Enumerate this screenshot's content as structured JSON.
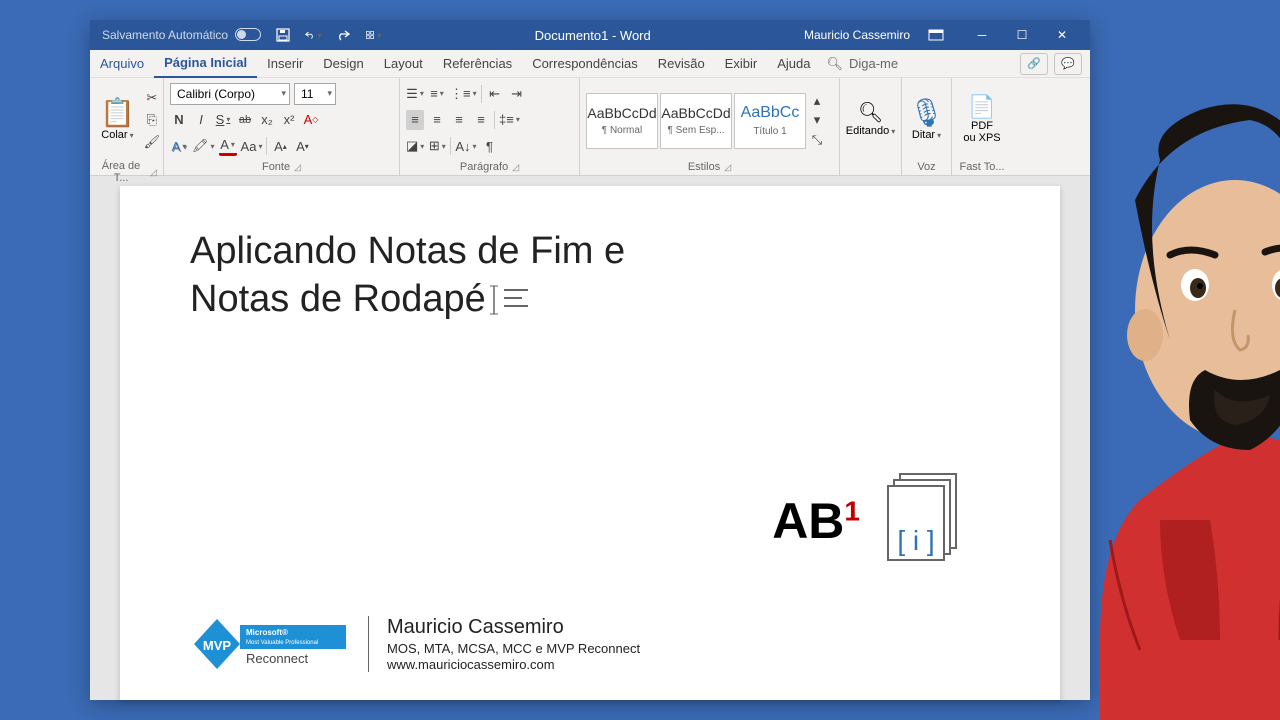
{
  "titlebar": {
    "autosave_label": "Salvamento Automático",
    "doc_title": "Documento1 - Word",
    "username": "Mauricio Cassemiro"
  },
  "tabs": {
    "file": "Arquivo",
    "home": "Página Inicial",
    "insert": "Inserir",
    "design": "Design",
    "layout": "Layout",
    "references": "Referências",
    "mailings": "Correspondências",
    "review": "Revisão",
    "view": "Exibir",
    "help": "Ajuda",
    "tellme": "Diga-me"
  },
  "ribbon": {
    "clipboard": {
      "label": "Área de T...",
      "paste": "Colar"
    },
    "font": {
      "label": "Fonte",
      "name": "Calibri (Corpo)",
      "size": "11",
      "bold": "N",
      "italic": "I",
      "underline": "S",
      "strike": "ab",
      "sub": "x₂",
      "sup": "x²",
      "clear": "A",
      "effects": "A",
      "highlight": "✎",
      "color": "A",
      "case": "Aa",
      "grow": "A▴",
      "shrink": "A▾"
    },
    "paragraph": {
      "label": "Parágrafo"
    },
    "styles": {
      "label": "Estilos",
      "s1": {
        "preview": "AaBbCcDd",
        "name": "¶ Normal"
      },
      "s2": {
        "preview": "AaBbCcDd",
        "name": "¶ Sem Esp..."
      },
      "s3": {
        "preview": "AaBbCc",
        "name": "Título 1"
      }
    },
    "editing": {
      "label": "Editando"
    },
    "voice": {
      "label": "Voz",
      "dictate": "Ditar"
    },
    "fasttools": {
      "label": "Fast To...",
      "pdf": "PDF",
      "xps": "ou XPS"
    }
  },
  "document": {
    "line1": "Aplicando Notas de Fim e",
    "line2": "Notas de Rodapé",
    "ab": "AB",
    "sup": "1",
    "endnote": "[ i ]"
  },
  "signature": {
    "mvp_top": "Microsoft®",
    "mvp_mid": "Most Valuable Professional",
    "mvp_bottom": "Reconnect",
    "name": "Mauricio Cassemiro",
    "certs": "MOS, MTA, MCSA, MCC e MVP Reconnect",
    "url": "www.mauriciocassemiro.com"
  }
}
